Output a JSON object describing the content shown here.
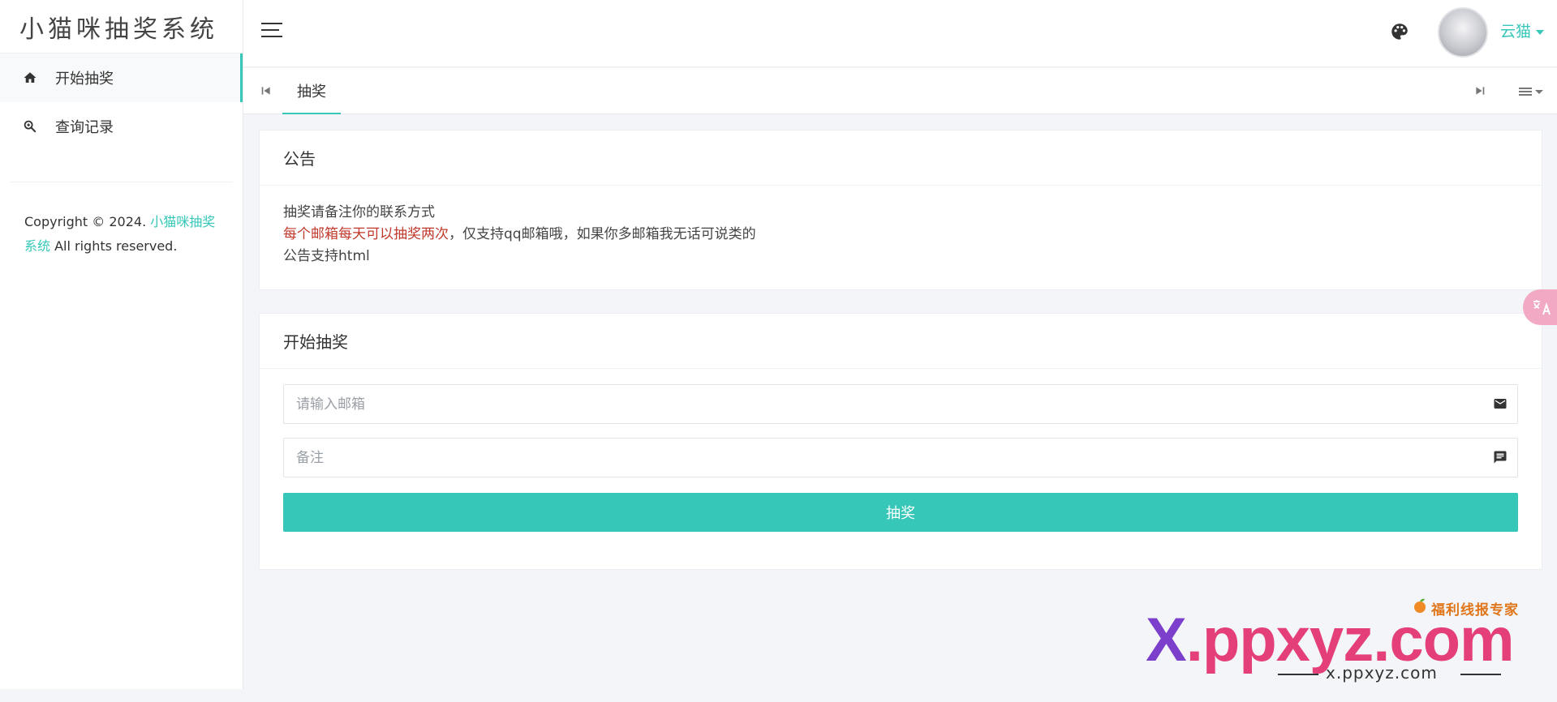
{
  "app": {
    "logo": "小猫咪抽奖系统"
  },
  "sidebar": {
    "items": [
      {
        "label": "开始抽奖",
        "icon": "home-icon",
        "active": true
      },
      {
        "label": "查询记录",
        "icon": "search-zoom-icon",
        "active": false
      }
    ],
    "copyright_prefix": "Copyright © 2024. ",
    "copyright_link": "小猫咪抽奖系统",
    "copyright_suffix": " All rights reserved."
  },
  "topbar": {
    "username": "云猫",
    "accent": "#36c7b9"
  },
  "tabs": {
    "items": [
      {
        "label": "抽奖",
        "active": true
      }
    ]
  },
  "notice": {
    "title": "公告",
    "line1": "抽奖请备注你的联系方式",
    "line2_red": "每个邮箱每天可以抽奖两次",
    "line2_rest": "，仅支持qq邮箱哦，如果你多邮箱我无话可说类的",
    "line3": "公告支持html",
    "red_color": "#c0392b"
  },
  "draw": {
    "title": "开始抽奖",
    "email_placeholder": "请输入邮箱",
    "email_value": "",
    "note_placeholder": "备注",
    "note_value": "",
    "submit_label": "抽奖"
  },
  "watermark": {
    "top_text": "福利线报专家",
    "main_x": "X",
    "main_rest": ".ppxyz.com",
    "sub_text": "x.ppxyz.com"
  }
}
